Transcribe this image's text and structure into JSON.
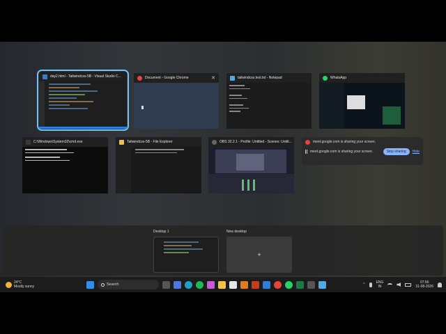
{
  "windows": [
    {
      "title": "day2.html - Tailwindcss-5B - Visual Studio C...",
      "icon": "vscode-icon",
      "color": "#2f7fd8"
    },
    {
      "title": "Document - Google Chrome",
      "icon": "chrome-icon",
      "color": "#e5443a",
      "close": "✕"
    },
    {
      "title": "tailwindcss.text.txt - Notepad",
      "icon": "notepad-icon",
      "color": "#52a8e0"
    },
    {
      "title": "WhatsApp",
      "icon": "whatsapp-icon",
      "color": "#25d366"
    },
    {
      "title": "C:\\Windows\\System32\\cmd.exe",
      "icon": "cmd-icon",
      "color": "#3a3a3a"
    },
    {
      "title": "Tailwindcss-5B - File Explorer",
      "icon": "folder-icon",
      "color": "#f1c14a"
    },
    {
      "title": "OBS 32.2.1 - Profile: Untitled - Scenes: Untitl...",
      "icon": "obs-icon",
      "color": "#666666"
    }
  ],
  "share_popup": {
    "title": "meet.google.com is sharing your screen.",
    "message": "meet.google.com is sharing your screen.",
    "stop_label": "Stop sharing",
    "hide_label": "Hide"
  },
  "desktops": {
    "desktop1_label": "Desktop 1",
    "new_label": "New desktop",
    "plus": "+"
  },
  "taskbar": {
    "temp": "24°C",
    "weather": "Mostly sunny",
    "search_label": "Search",
    "lang1": "ENG",
    "lang2": "IN",
    "time": "07:56",
    "date": "31-08-2026",
    "chevron": "^"
  }
}
